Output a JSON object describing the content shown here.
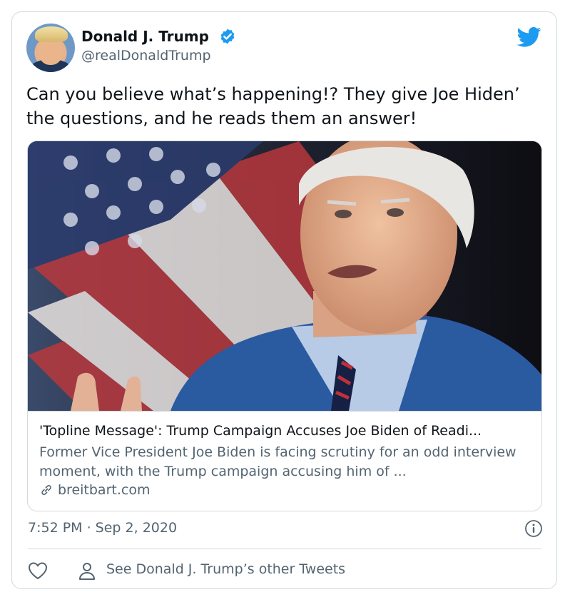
{
  "tweet": {
    "author_name": "Donald J. Trump",
    "author_handle": "@realDonaldTrump",
    "text": "Can you believe what’s happening!? They give Joe Hiden’ the questions, and he reads them an answer!",
    "timestamp": "7:52 PM · Sep 2, 2020"
  },
  "link_card": {
    "title": "'Topline Message': Trump Campaign Accuses Joe Biden of Readi...",
    "description": "Former Vice President Joe Biden is facing scrutiny for an odd interview moment, with the Trump campaign accusing him of ...",
    "domain": "breitbart.com"
  },
  "footer": {
    "other_tweets_label": "See Donald J. Trump’s other Tweets"
  },
  "colors": {
    "twitter_blue": "#1d9bf0",
    "secondary_text": "#536471",
    "border": "#cfd9de"
  },
  "icons": [
    "verified-badge-icon",
    "twitter-bird-icon",
    "link-icon",
    "info-icon",
    "heart-icon",
    "person-icon"
  ]
}
